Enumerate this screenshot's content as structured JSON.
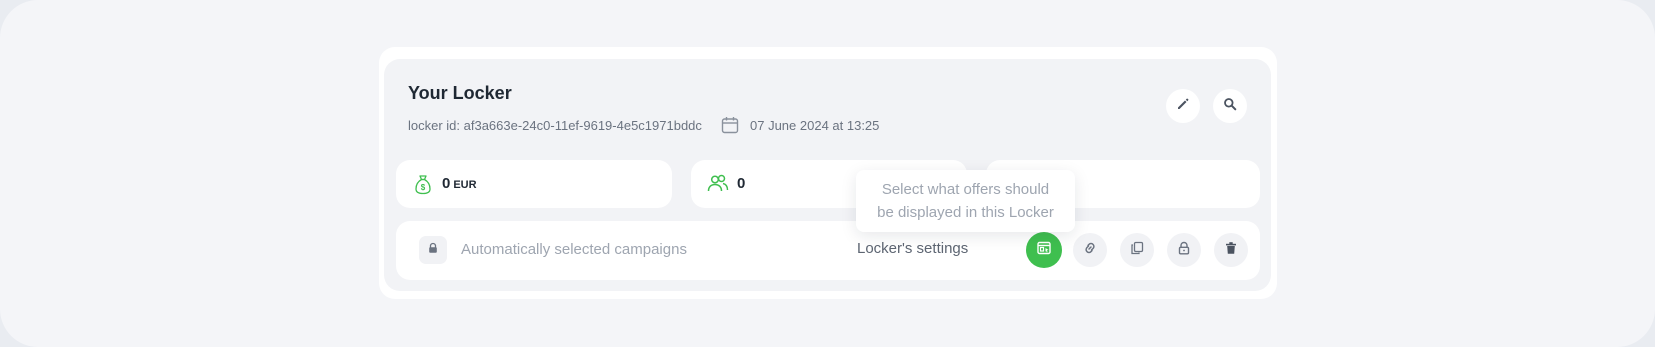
{
  "header": {
    "title": "Your Locker",
    "locker_id": "locker id: af3a663e-24c0-11ef-9619-4e5c1971bddc",
    "date": "07 June 2024 at 13:25"
  },
  "stats": {
    "earnings_value": "0",
    "earnings_unit": "EUR",
    "users_value": "0"
  },
  "campaigns_row": {
    "label": "Automatically selected campaigns",
    "settings_label": "Locker's settings"
  },
  "tooltip": {
    "line1": "Select what offers should",
    "line2": "be displayed in this Locker"
  },
  "colors": {
    "accent_green": "#3fbf4f",
    "text_dark": "#1f2833",
    "text_muted": "#9ea5b0"
  },
  "icons": [
    "calendar-icon",
    "pencil-icon",
    "search-icon",
    "money-bag-icon",
    "users-icon",
    "lock-icon",
    "offers-select-icon",
    "link-icon",
    "copy-icon",
    "trash-icon"
  ]
}
